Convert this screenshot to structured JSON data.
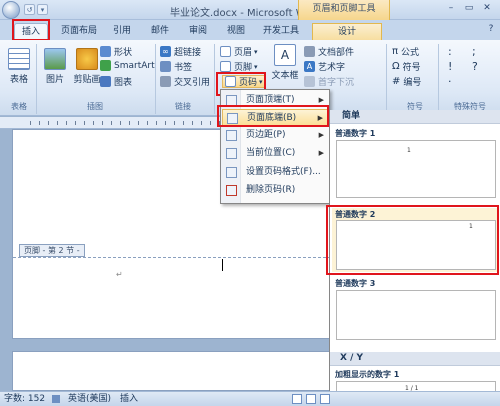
{
  "window": {
    "title": "毕业论文.docx - Microsoft Word",
    "context_title": "页眉和页脚工具",
    "qat_undo_glyph": "↺"
  },
  "tabs": [
    {
      "label": "插入",
      "active": true
    },
    {
      "label": "页面布局"
    },
    {
      "label": "引用"
    },
    {
      "label": "邮件"
    },
    {
      "label": "审阅"
    },
    {
      "label": "视图"
    },
    {
      "label": "开发工具"
    },
    {
      "label": "设计",
      "contextual": true
    }
  ],
  "ribbon": {
    "tables": {
      "table_label": "表格",
      "group_label": "表格"
    },
    "illustrations": {
      "picture": "图片",
      "clipart": "剪贴画",
      "shapes": "形状",
      "smartart": "SmartArt",
      "chart": "图表",
      "group_label": "插图"
    },
    "links": {
      "hyperlink": "超链接",
      "bookmark": "书签",
      "crossref": "交叉引用",
      "group_label": "链接"
    },
    "header_footer": {
      "header": "页眉",
      "footer": "页脚",
      "page_number": "页码"
    },
    "text": {
      "textbox": "文本框",
      "doc_parts": "文档部件",
      "wordart": "艺术字",
      "dropcap": "首字下沉"
    },
    "symbols": {
      "formula": "公式",
      "symbol": "符号",
      "numbering": "编号",
      "group_label": "符号"
    },
    "special": {
      "chars": [
        ":",
        ";",
        "!",
        "?",
        "·"
      ],
      "group_label": "特殊符号"
    }
  },
  "document": {
    "footer_label": "页脚 - 第 2 节 -"
  },
  "page_number_menu": {
    "items": [
      {
        "label": "页面顶端(T)",
        "submenu": true
      },
      {
        "label": "页面底端(B)",
        "submenu": true,
        "highlighted": true
      },
      {
        "label": "页边距(P)",
        "submenu": true
      },
      {
        "label": "当前位置(C)",
        "submenu": true
      },
      {
        "label": "设置页码格式(F)..."
      },
      {
        "label": "删除页码(R)"
      }
    ]
  },
  "gallery": {
    "section1_title": "简单",
    "items": [
      {
        "label": "普通数字 1",
        "number": "1"
      },
      {
        "label": "普通数字 2",
        "number": "1"
      },
      {
        "label": "普通数字 3",
        "number": ""
      }
    ],
    "section2_title": "X / Y",
    "bold_label": "加粗显示的数字 1",
    "bold_preview": "1 / 1"
  },
  "statusbar": {
    "word_count": "字数: 152",
    "language": "英语(美国)",
    "mode": "插入"
  }
}
